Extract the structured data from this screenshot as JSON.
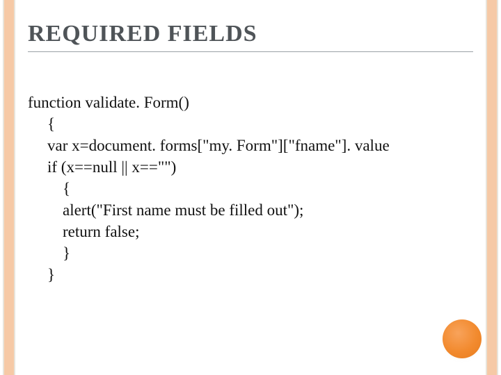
{
  "title": "REQUIRED FIELDS",
  "code": {
    "l1": "function validate. Form()",
    "l2": "{",
    "l3": "var x=document. forms[\"my. Form\"][\"fname\"]. value",
    "l4": "if (x==null || x==\"\")",
    "l5": "{",
    "l6": "alert(\"First name must be filled out\");",
    "l7": "return false;",
    "l8": "}",
    "l9": "}"
  },
  "colors": {
    "stripe": "#f6c9a6",
    "accent": "#f28a2e",
    "heading": "#4f5458"
  }
}
